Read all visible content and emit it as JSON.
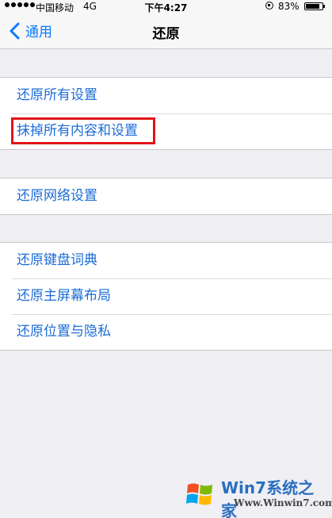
{
  "status_bar": {
    "carrier": "中国移动",
    "network": "4G",
    "time": "下午4:27",
    "battery": "83%",
    "battery_level": 0.83
  },
  "nav": {
    "back_label": "通用",
    "title": "还原"
  },
  "groups": [
    {
      "items": [
        "还原所有设置",
        "抹掉所有内容和设置"
      ]
    },
    {
      "items": [
        "还原网络设置"
      ]
    },
    {
      "items": [
        "还原键盘词典",
        "还原主屏幕布局",
        "还原位置与隐私"
      ]
    }
  ],
  "watermark": {
    "title": "Win7系统之家",
    "url": "Www.Winwin7.com"
  },
  "colors": {
    "accent": "#0a7aff",
    "row_text": "#1c6cd6",
    "highlight": "#e2151a",
    "background": "#efeff4"
  }
}
